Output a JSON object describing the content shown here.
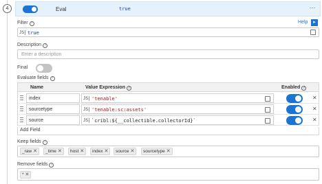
{
  "step": {
    "number": "4"
  },
  "header": {
    "function_name": "Eval",
    "description": "true",
    "enabled": true,
    "menu_glyph": "⋯"
  },
  "help": {
    "label": "Help",
    "glyph": "▸"
  },
  "filter": {
    "label": "Filter",
    "lang": "JS",
    "value": "true"
  },
  "description": {
    "label": "Description",
    "placeholder": "Enter a description"
  },
  "final": {
    "label": "Final",
    "enabled": false
  },
  "evaluate_fields": {
    "label": "Evaluate fields",
    "columns": {
      "name": "Name",
      "value_expression": "Value Expression",
      "enabled": "Enabled"
    },
    "rows": [
      {
        "name": "index",
        "lang": "JS",
        "expression": "'tenable'",
        "enabled": true
      },
      {
        "name": "sourcetype",
        "lang": "JS",
        "expression": "'tenable:sc:assets'",
        "enabled": true
      },
      {
        "name": "source",
        "lang": "JS",
        "expression": "`cribl:${__collectible.collectorId}`",
        "enabled": true
      }
    ],
    "add_label": "Add Field"
  },
  "keep_fields": {
    "label": "Keep fields",
    "items": [
      "_raw",
      "_time",
      "host",
      "index",
      "source",
      "sourcetype"
    ]
  },
  "remove_fields": {
    "label": "Remove fields",
    "items": [
      "*"
    ]
  },
  "icons": {
    "question": "?",
    "remove": "✕"
  },
  "colors": {
    "accent": "#1b75d0",
    "header_bg": "#e6f2fb",
    "code_string": "#a31515",
    "code_literal": "#1b3fb5"
  }
}
